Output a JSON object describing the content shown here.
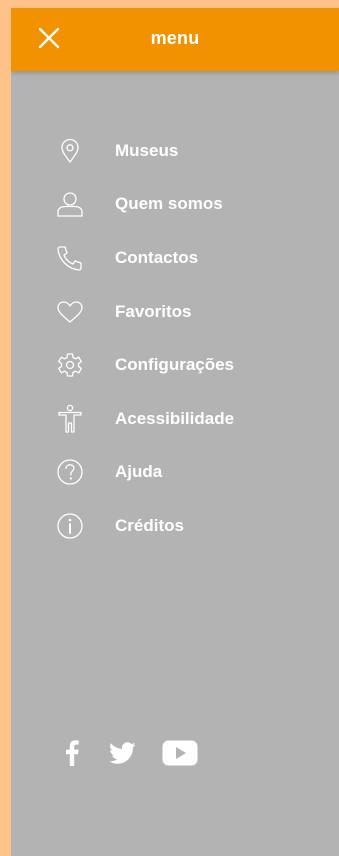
{
  "header": {
    "title": "menu",
    "close_icon": "close-icon",
    "background": "#F39200"
  },
  "menu": {
    "items": [
      {
        "label": "Museus",
        "icon": "location-pin-icon"
      },
      {
        "label": "Quem somos",
        "icon": "person-icon"
      },
      {
        "label": "Contactos",
        "icon": "phone-icon"
      },
      {
        "label": "Favoritos",
        "icon": "heart-icon"
      },
      {
        "label": "Configurações",
        "icon": "gear-icon"
      },
      {
        "label": "Acessibilidade",
        "icon": "accessibility-icon"
      },
      {
        "label": "Ajuda",
        "icon": "help-icon"
      },
      {
        "label": "Créditos",
        "icon": "info-icon"
      }
    ]
  },
  "social": {
    "items": [
      {
        "icon": "facebook-icon"
      },
      {
        "icon": "twitter-icon"
      },
      {
        "icon": "youtube-icon"
      }
    ]
  },
  "colors": {
    "page_background": "#FFC389",
    "panel_background": "#B3B3B3",
    "accent": "#F39200",
    "text": "#FFFFFF"
  }
}
